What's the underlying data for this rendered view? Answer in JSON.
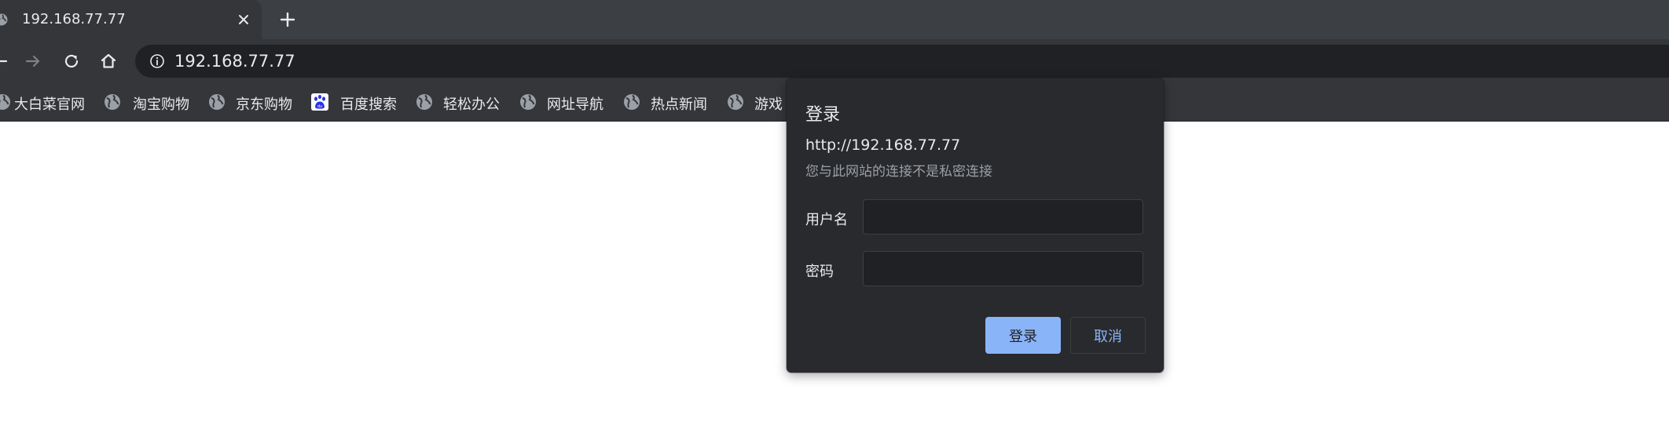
{
  "tab": {
    "title": "192.168.77.77",
    "favicon": "globe-icon",
    "close": "close-icon",
    "new_tab": "plus-icon"
  },
  "toolbar": {
    "back": "back-arrow-icon",
    "forward": "forward-arrow-icon",
    "reload": "reload-icon",
    "home": "home-icon",
    "url": "192.168.77.77",
    "site_info": "info-icon"
  },
  "bookmarks": [
    {
      "label": "大白菜官网",
      "icon": "globe-icon"
    },
    {
      "label": "淘宝购物",
      "icon": "globe-icon"
    },
    {
      "label": "京东购物",
      "icon": "globe-icon"
    },
    {
      "label": "百度搜索",
      "icon": "baidu-paw-icon"
    },
    {
      "label": "轻松办公",
      "icon": "globe-icon"
    },
    {
      "label": "网址导航",
      "icon": "globe-icon"
    },
    {
      "label": "热点新闻",
      "icon": "globe-icon"
    },
    {
      "label": "游戏",
      "icon": "globe-icon"
    }
  ],
  "dialog": {
    "title": "登录",
    "url": "http://192.168.77.77",
    "note": "您与此网站的连接不是私密连接",
    "username_label": "用户名",
    "username_value": "",
    "password_label": "密码",
    "password_value": "",
    "login_button": "登录",
    "cancel_button": "取消"
  },
  "colors": {
    "chrome_dark": "#35363a",
    "tabstrip": "#3c3f43",
    "omnibox": "#202124",
    "dialog_bg": "#292a2d",
    "accent": "#8ab4f8",
    "text": "#e8eaed",
    "muted_text": "#9aa0a6"
  }
}
